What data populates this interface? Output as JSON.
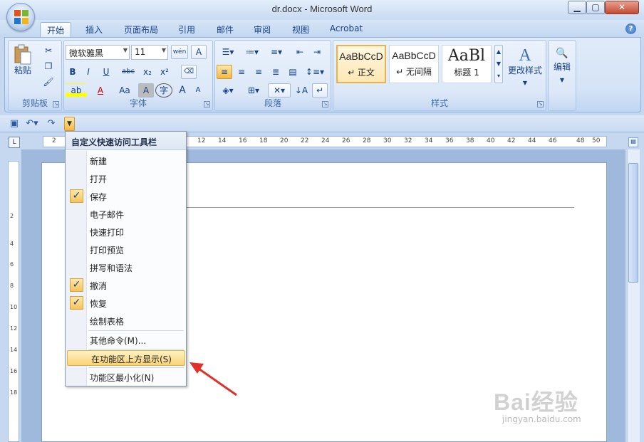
{
  "window": {
    "title": "dr.docx - Microsoft Word"
  },
  "tabs": [
    "开始",
    "插入",
    "页面布局",
    "引用",
    "邮件",
    "审阅",
    "视图",
    "Acrobat"
  ],
  "ribbon": {
    "clipboard": {
      "label": "剪贴板",
      "paste_label": "粘贴"
    },
    "font": {
      "label": "字体",
      "font_name": "微软雅黑",
      "font_size": "11",
      "bold": "B",
      "italic": "I",
      "underline": "U",
      "strike": "abc",
      "subscript": "x₂",
      "superscript": "x²",
      "highlight": "ab",
      "font_color": "A",
      "case": "Aa",
      "char_shade": "A",
      "enclose": "字",
      "grow": "A",
      "shrink": "A",
      "phonetic": "wén",
      "border_char": "A"
    },
    "paragraph": {
      "label": "段落"
    },
    "styles": {
      "label": "样式",
      "items": [
        {
          "sample": "AaBbCcD",
          "name": "↵ 正文"
        },
        {
          "sample": "AaBbCcD",
          "name": "↵ 无间隔"
        },
        {
          "sample": "AaBl",
          "name": "标题 1"
        }
      ],
      "change_styles": "更改样式"
    },
    "editing": {
      "label": "编辑"
    }
  },
  "qat_menu": {
    "title": "自定义快速访问工具栏",
    "items": [
      {
        "label": "新建",
        "checked": false
      },
      {
        "label": "打开",
        "checked": false
      },
      {
        "label": "保存",
        "checked": true
      },
      {
        "label": "电子邮件",
        "checked": false
      },
      {
        "label": "快速打印",
        "checked": false
      },
      {
        "label": "打印预览",
        "checked": false
      },
      {
        "label": "拼写和语法",
        "checked": false
      },
      {
        "label": "撤消",
        "checked": true
      },
      {
        "label": "恢复",
        "checked": true
      },
      {
        "label": "绘制表格",
        "checked": false
      }
    ],
    "more_commands": "其他命令(M)...",
    "show_above": "在功能区上方显示(S)",
    "minimize_ribbon": "功能区最小化(N)",
    "checkmark": "✓"
  },
  "ruler": {
    "h_numbers": [
      "2",
      "12",
      "14",
      "16",
      "18",
      "20",
      "22",
      "24",
      "26",
      "28",
      "30",
      "32",
      "34",
      "36",
      "38",
      "40",
      "42",
      "44",
      "46",
      "48",
      "50"
    ],
    "v_numbers": [
      "2",
      "4",
      "6",
      "8",
      "10",
      "12",
      "14",
      "16",
      "18"
    ]
  },
  "watermark": {
    "brand": "Bai经验",
    "url": "jingyan.baidu.com"
  },
  "colors": {
    "accent": "#15428b",
    "highlight": "#f8d476",
    "arrow": "#e0302a"
  }
}
